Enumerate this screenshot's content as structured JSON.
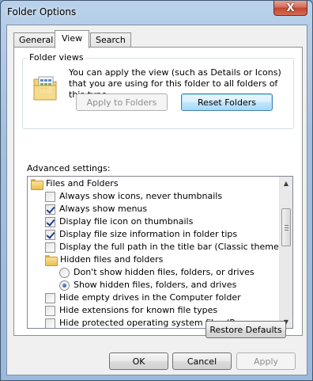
{
  "window": {
    "title": "Folder Options",
    "close_glyph": "X"
  },
  "tabs": [
    {
      "label": "General",
      "active": false
    },
    {
      "label": "View",
      "active": true
    },
    {
      "label": "Search",
      "active": false
    }
  ],
  "folder_views": {
    "group_label": "Folder views",
    "description": "You can apply the view (such as Details or Icons) that you are using for this folder to all folders of this type.",
    "apply_to_folders_label": "Apply to Folders",
    "apply_to_folders_enabled": false,
    "reset_folders_label": "Reset Folders",
    "icon": "folder-view-icon"
  },
  "advanced": {
    "label": "Advanced settings:",
    "items": [
      {
        "type": "folder",
        "label": "Files and Folders"
      },
      {
        "type": "checkbox",
        "label": "Always show icons, never thumbnails",
        "checked": false
      },
      {
        "type": "checkbox",
        "label": "Always show menus",
        "checked": true
      },
      {
        "type": "checkbox",
        "label": "Display file icon on thumbnails",
        "checked": true
      },
      {
        "type": "checkbox",
        "label": "Display file size information in folder tips",
        "checked": true
      },
      {
        "type": "checkbox",
        "label": "Display the full path in the title bar (Classic theme only)",
        "checked": false
      },
      {
        "type": "folder",
        "label": "Hidden files and folders"
      },
      {
        "type": "radio",
        "label": "Don't show hidden files, folders, or drives",
        "checked": false
      },
      {
        "type": "radio",
        "label": "Show hidden files, folders, and drives",
        "checked": true
      },
      {
        "type": "checkbox",
        "label": "Hide empty drives in the Computer folder",
        "checked": false
      },
      {
        "type": "checkbox",
        "label": "Hide extensions for known file types",
        "checked": false
      },
      {
        "type": "checkbox",
        "label": "Hide protected operating system files (Recommended)",
        "checked": false
      }
    ]
  },
  "buttons": {
    "restore_defaults": "Restore Defaults",
    "ok": "OK",
    "cancel": "Cancel",
    "apply": "Apply",
    "apply_enabled": false
  },
  "colors": {
    "frame": "#b9d1ea",
    "close_button": "#c2452f",
    "checkmark": "#1c3f84"
  }
}
